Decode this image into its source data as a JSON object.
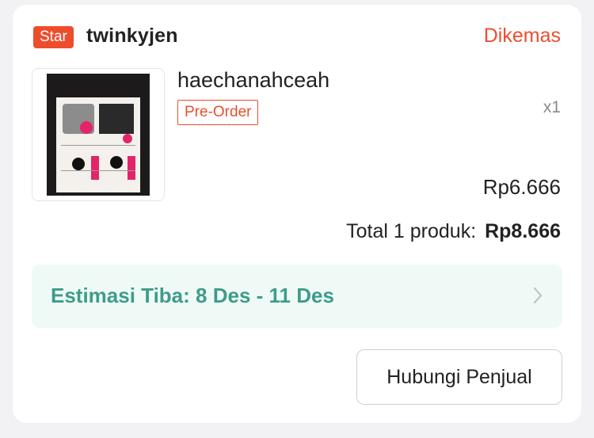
{
  "order": {
    "badge": "Star",
    "shop_name": "twinkyjen",
    "status": "Dikemas",
    "product": {
      "name": "haechanahceah",
      "tag": "Pre-Order",
      "quantity": "x1",
      "price": "Rp6.666"
    },
    "total_label": "Total 1 produk:",
    "total_value": "Rp8.666",
    "estimate": "Estimasi Tiba: 8 Des - 11 Des",
    "contact_button": "Hubungi Penjual"
  },
  "colors": {
    "accent": "#ee4d2d",
    "estimate_text": "#3e9c8a",
    "estimate_bg": "#effaf7"
  },
  "icons": {
    "estimate_chevron": "chevron-right-icon",
    "thumbnail": "product-thumbnail"
  }
}
